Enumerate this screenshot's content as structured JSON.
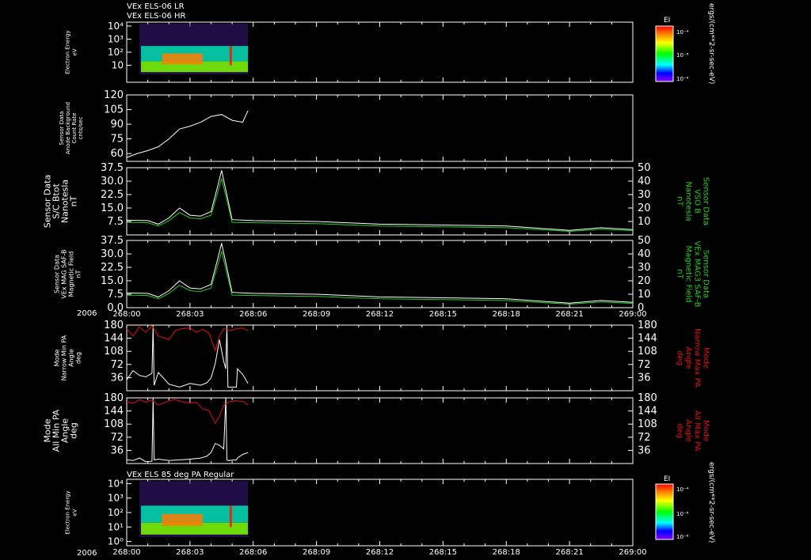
{
  "header": {
    "title_line1": "VEx ELS-06 LR",
    "title_line2": "VEx ELS-06 HR",
    "bottom_panel_title": "VEx ELS 85 deg PA Regular",
    "year": "2006"
  },
  "time_axis": {
    "tick_labels": [
      "268:00",
      "268:03",
      "268:06",
      "268:09",
      "268:12",
      "268:15",
      "268:18",
      "268:21",
      "269:00"
    ]
  },
  "colorbar": {
    "label": "EI",
    "ticks": [
      "10⁻⁴",
      "10⁻⁶",
      "10⁻⁸"
    ],
    "units": "ergs/(cm**2-sr-sec-eV)"
  },
  "colors": {
    "background": "#000000",
    "frame": "#ffffff",
    "magnitude_trace": "#ffffff",
    "component_trace": "#22cc22",
    "max_pa_trace": "#dd1111"
  },
  "chart_data": [
    {
      "id": "els-spectrogram-top",
      "type": "heatmap",
      "ylabel": [
        "Electron Energy",
        "eV"
      ],
      "yscale": "log",
      "yticks": [
        "10⁴",
        "10³",
        "10²",
        "10"
      ],
      "bands": [
        {
          "t0": 0.0,
          "t1": 5.75,
          "e0": 3,
          "e1": 20,
          "level": "yellow-green"
        },
        {
          "t0": 0.0,
          "t1": 5.75,
          "e0": 20,
          "e1": 300,
          "level": "green-cyan"
        },
        {
          "t0": 1.0,
          "t1": 3.6,
          "e0": 12,
          "e1": 80,
          "level": "orange-red"
        },
        {
          "t0": 4.2,
          "t1": 4.7,
          "e0": 10,
          "e1": 300,
          "level": "red"
        }
      ],
      "x_range": [
        0,
        24
      ]
    },
    {
      "id": "background-counts",
      "type": "line",
      "ylabel": [
        "Sensor Data",
        "Anode Background",
        "Count Rate",
        "cnts/sec"
      ],
      "yticks": [
        60,
        75,
        90,
        105,
        120
      ],
      "ylim": [
        52,
        120
      ],
      "series": [
        {
          "x": [
            0,
            0.5,
            1.0,
            1.5,
            2.0,
            2.5,
            3.0,
            3.5,
            4.0,
            4.5,
            5.0,
            5.5,
            5.75
          ],
          "y": [
            56,
            60,
            63,
            67,
            75,
            85,
            88,
            92,
            98,
            100,
            94,
            92,
            104
          ]
        }
      ]
    },
    {
      "id": "bmag-vso",
      "type": "line",
      "ylabel": [
        "Sensor Data",
        "S/C Btot",
        "Nanotesla",
        "nT"
      ],
      "ylabel_right": [
        "Sensor Data",
        "VSO B",
        "Nanotesla",
        "nT"
      ],
      "yticks": [
        7.5,
        15.0,
        22.5,
        30.0,
        37.5
      ],
      "ylim": [
        0,
        37.5
      ],
      "yticks_right": [
        10,
        20,
        30,
        40,
        50
      ],
      "ylim_right": [
        0,
        50
      ],
      "series": [
        {
          "name": "Btot",
          "x": [
            0,
            1,
            1.5,
            2,
            2.5,
            3,
            3.5,
            4,
            4.3,
            4.5,
            5,
            6,
            9,
            12,
            15,
            18,
            21,
            22.5,
            24
          ],
          "y": [
            8.2,
            8.0,
            6.0,
            9.5,
            15.0,
            11.0,
            10.5,
            13.0,
            26.5,
            36.0,
            8.5,
            8.0,
            7.5,
            6.0,
            5.5,
            5.0,
            2.5,
            4.0,
            3.0
          ]
        },
        {
          "name": "VSO B",
          "x": [
            0,
            1,
            1.5,
            2,
            2.5,
            3,
            3.5,
            4,
            4.3,
            4.5,
            5,
            6,
            9,
            12,
            15,
            18,
            21,
            22.5,
            24
          ],
          "y": [
            7.0,
            6.8,
            5.0,
            8.0,
            12.5,
            9.5,
            9.0,
            11.0,
            23.0,
            31.5,
            7.0,
            6.8,
            6.3,
            5.0,
            4.5,
            4.0,
            2.0,
            3.2,
            2.4
          ]
        }
      ]
    },
    {
      "id": "bmag-saf",
      "type": "line",
      "ylabel": [
        "Sensor Data",
        "VEx MAG SAF-B",
        "Magnetic Field",
        "nT"
      ],
      "ylabel_right": [
        "Sensor Data",
        "VEx MAG3 SAF-B",
        "Magnetic Field",
        "nT"
      ],
      "yticks": [
        0.0,
        7.5,
        15.0,
        22.5,
        30.0,
        37.5
      ],
      "ylim": [
        0,
        37.5
      ],
      "yticks_right": [
        0,
        10,
        20,
        30,
        40,
        50
      ],
      "ylim_right": [
        0,
        50
      ],
      "series": [
        {
          "name": "SAF-B",
          "x": [
            0,
            1,
            1.5,
            2,
            2.5,
            3,
            3.5,
            4,
            4.3,
            4.5,
            5,
            6,
            9,
            12,
            15,
            18,
            21,
            22.5,
            24
          ],
          "y": [
            8.2,
            8.0,
            6.0,
            9.5,
            15.0,
            11.0,
            10.5,
            13.0,
            26.5,
            36.0,
            8.5,
            8.0,
            7.5,
            6.0,
            5.5,
            5.0,
            2.5,
            4.0,
            3.0
          ]
        },
        {
          "name": "MAG3 SAF-B",
          "x": [
            0,
            1,
            1.5,
            2,
            2.5,
            3,
            3.5,
            4,
            4.3,
            4.5,
            5,
            6,
            9,
            12,
            15,
            18,
            21,
            22.5,
            24
          ],
          "y": [
            7.0,
            6.8,
            5.0,
            8.0,
            12.5,
            9.5,
            9.0,
            11.0,
            23.0,
            31.5,
            7.0,
            6.8,
            6.3,
            5.0,
            4.5,
            4.0,
            2.0,
            3.2,
            2.4
          ]
        }
      ]
    },
    {
      "id": "narrow-pa",
      "type": "line",
      "ylabel": [
        "Mode",
        "Narrow Min PA",
        "Angle",
        "deg"
      ],
      "ylabel_right": [
        "Mode",
        "Narrow Max PA",
        "Angle",
        "deg"
      ],
      "yticks": [
        36,
        72,
        108,
        144,
        180
      ],
      "ylim": [
        0,
        180
      ],
      "yticks_right": [
        36,
        72,
        108,
        144,
        180
      ],
      "ylim_right": [
        0,
        180
      ],
      "series": [
        {
          "name": "Min PA",
          "x": [
            0,
            0.3,
            0.6,
            0.9,
            1.2,
            1.25,
            1.3,
            1.5,
            2.0,
            2.5,
            3.0,
            3.5,
            3.8,
            4.0,
            4.2,
            4.4,
            4.6,
            4.7,
            4.75,
            4.8,
            5.2,
            5.25,
            5.5,
            5.75
          ],
          "y": [
            30,
            55,
            42,
            38,
            48,
            180,
            15,
            50,
            18,
            10,
            20,
            15,
            22,
            35,
            75,
            140,
            80,
            60,
            180,
            10,
            10,
            60,
            45,
            20
          ]
        },
        {
          "name": "Max PA",
          "x": [
            0,
            0.3,
            0.6,
            0.9,
            1.2,
            1.5,
            2.0,
            2.3,
            2.6,
            3.0,
            3.3,
            3.6,
            3.9,
            4.2,
            4.4,
            4.6,
            4.9,
            5.2,
            5.5,
            5.75
          ],
          "y": [
            170,
            150,
            175,
            160,
            178,
            150,
            140,
            165,
            170,
            172,
            160,
            168,
            158,
            110,
            150,
            170,
            165,
            170,
            172,
            165
          ]
        }
      ]
    },
    {
      "id": "all-pa",
      "type": "line",
      "ylabel": [
        "Mode",
        "All Min PA",
        "Angle",
        "deg"
      ],
      "ylabel_right": [
        "Mode",
        "All Max PA",
        "Angle",
        "deg"
      ],
      "yticks": [
        36,
        72,
        108,
        144,
        180
      ],
      "ylim": [
        0,
        180
      ],
      "yticks_right": [
        36,
        72,
        108,
        144,
        180
      ],
      "ylim_right": [
        0,
        180
      ],
      "series": [
        {
          "name": "Min PA",
          "x": [
            0,
            0.3,
            0.6,
            0.9,
            1.2,
            1.25,
            1.3,
            1.5,
            2.0,
            2.5,
            3.0,
            3.5,
            3.8,
            4.0,
            4.2,
            4.4,
            4.6,
            4.7,
            4.75,
            4.8,
            5.2,
            5.25,
            5.5,
            5.75
          ],
          "y": [
            10,
            8,
            15,
            5,
            6,
            180,
            10,
            12,
            8,
            10,
            12,
            15,
            20,
            30,
            55,
            50,
            40,
            180,
            10,
            8,
            10,
            15,
            25,
            30
          ]
        },
        {
          "name": "Max PA",
          "x": [
            0,
            0.3,
            0.6,
            0.9,
            1.2,
            1.5,
            2.0,
            2.3,
            2.6,
            3.0,
            3.3,
            3.6,
            3.9,
            4.2,
            4.4,
            4.6,
            4.9,
            5.2,
            5.5,
            5.75
          ],
          "y": [
            170,
            165,
            175,
            168,
            174,
            160,
            172,
            175,
            170,
            165,
            168,
            150,
            145,
            110,
            130,
            160,
            170,
            172,
            170,
            160
          ]
        }
      ]
    },
    {
      "id": "els-spectrogram-bottom",
      "type": "heatmap",
      "ylabel": [
        "Electron Energy",
        "eV"
      ],
      "yscale": "log",
      "yticks": [
        "10⁴",
        "10³",
        "10²",
        "10¹",
        "10⁰"
      ],
      "bands": [
        {
          "t0": 0.0,
          "t1": 5.75,
          "e0": 3,
          "e1": 20,
          "level": "yellow-green"
        },
        {
          "t0": 0.0,
          "t1": 5.75,
          "e0": 20,
          "e1": 300,
          "level": "green-cyan"
        },
        {
          "t0": 1.0,
          "t1": 3.6,
          "e0": 12,
          "e1": 80,
          "level": "orange-red"
        },
        {
          "t0": 4.2,
          "t1": 4.7,
          "e0": 10,
          "e1": 300,
          "level": "red"
        }
      ],
      "x_range": [
        0,
        24
      ]
    }
  ]
}
